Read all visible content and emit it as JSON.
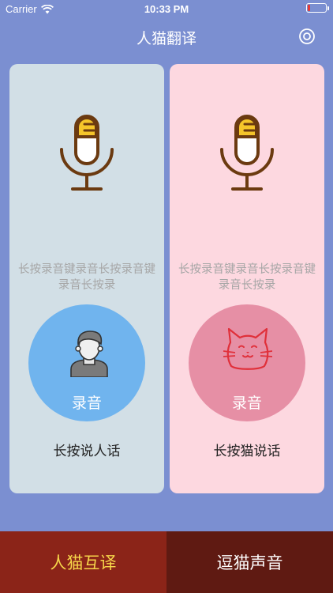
{
  "status_bar": {
    "carrier": "Carrier",
    "time": "10:33 PM",
    "battery_level": 0.12,
    "icons": [
      "wifi-icon",
      "battery-icon"
    ]
  },
  "nav": {
    "title": "人猫翻译",
    "settings_icon": "settings-icon"
  },
  "panels": {
    "human": {
      "hint": "长按录音键录音长按录音键录音长按录",
      "button_label": "录音",
      "caption": "长按说人话",
      "icons": [
        "microphone-icon",
        "person-avatar-icon"
      ]
    },
    "cat": {
      "hint": "长按录音键录音长按录音键录音长按录",
      "button_label": "录音",
      "caption": "长按猫说话",
      "icons": [
        "microphone-icon",
        "cat-face-icon"
      ]
    }
  },
  "tabs": {
    "translate": "人猫互译",
    "tease": "逗猫声音"
  },
  "colors": {
    "background": "#7b8fd1",
    "human_panel": "#d2dfe6",
    "cat_panel": "#fdd8e0",
    "human_button": "#70b4ee",
    "cat_button": "#e68fa5",
    "tab_active": "#8b2418",
    "tab_inactive": "#5f1a12",
    "tab_active_text": "#f7d64a"
  }
}
